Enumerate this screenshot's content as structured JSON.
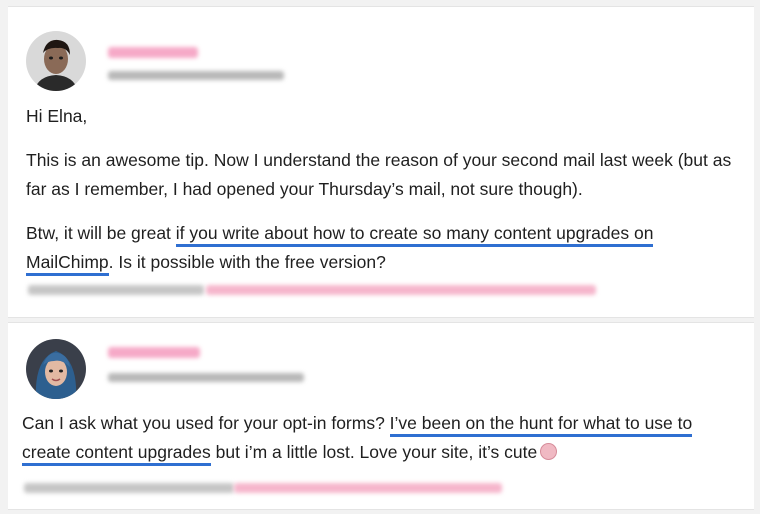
{
  "comments": [
    {
      "greeting": "Hi Elna,",
      "paragraph1": "This is an awesome tip. Now I understand the reason of your second mail last week (but as far as I remember, I had opened your Thursday’s mail, not sure though).",
      "paragraph2_before": "Btw, it will be great ",
      "paragraph2_highlight_line1": "if you write about how to create so many content upgrades on",
      "paragraph2_highlight_line2": "MailChimp",
      "paragraph2_after": ". Is it possible with the free version?"
    },
    {
      "text_before": "Can I ask what you used for your opt-in forms? ",
      "highlight_line1": "I’ve been on the hunt for what to use to",
      "highlight_line2": "create content upgrades",
      "text_after": " but i’m a little lost. Love your site, it’s cute"
    }
  ],
  "colors": {
    "highlight_underline": "#2f6fd1",
    "blurred_name": "#f6a9c7",
    "blurred_meta": "#b8b8b8",
    "background": "#f2f2f2"
  },
  "icons": {
    "comment1_avatar": "user-avatar-male",
    "comment2_avatar": "user-avatar-female",
    "emoji": "smiling-face-emoji"
  }
}
